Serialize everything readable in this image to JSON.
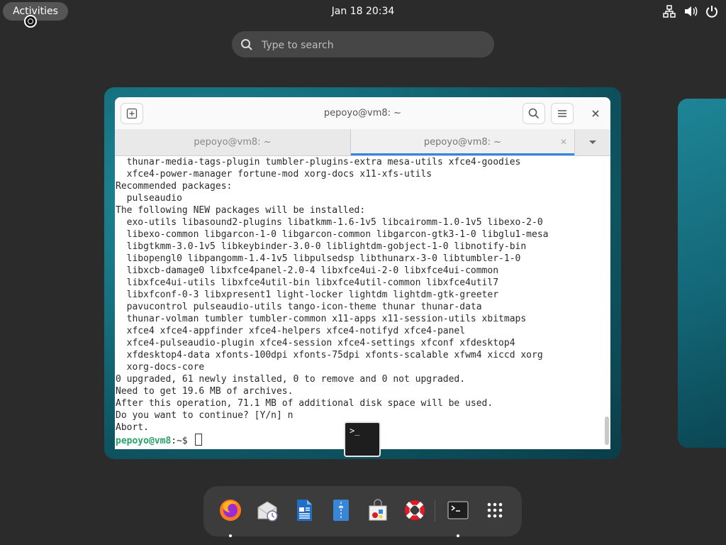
{
  "topbar": {
    "activities_label": "Activities",
    "datetime": "Jan 18  20:34",
    "tray_icons": [
      "network-icon",
      "volume-icon",
      "power-icon"
    ]
  },
  "search": {
    "placeholder": "Type to search"
  },
  "terminal": {
    "title": "pepoyo@vm8: ~",
    "tabs": [
      {
        "label": "pepoyo@vm8: ~",
        "active": false
      },
      {
        "label": "pepoyo@vm8: ~",
        "active": true
      }
    ],
    "lines": [
      "  thunar-media-tags-plugin tumbler-plugins-extra mesa-utils xfce4-goodies",
      "  xfce4-power-manager fortune-mod xorg-docs x11-xfs-utils",
      "Recommended packages:",
      "  pulseaudio",
      "The following NEW packages will be installed:",
      "  exo-utils libasound2-plugins libatkmm-1.6-1v5 libcairomm-1.0-1v5 libexo-2-0",
      "  libexo-common libgarcon-1-0 libgarcon-common libgarcon-gtk3-1-0 libglu1-mesa",
      "  libgtkmm-3.0-1v5 libkeybinder-3.0-0 liblightdm-gobject-1-0 libnotify-bin",
      "  libopengl0 libpangomm-1.4-1v5 libpulsedsp libthunarx-3-0 libtumbler-1-0",
      "  libxcb-damage0 libxfce4panel-2.0-4 libxfce4ui-2-0 libxfce4ui-common",
      "  libxfce4ui-utils libxfce4util-bin libxfce4util-common libxfce4util7",
      "  libxfconf-0-3 libxpresent1 light-locker lightdm lightdm-gtk-greeter",
      "  pavucontrol pulseaudio-utils tango-icon-theme thunar thunar-data",
      "  thunar-volman tumbler tumbler-common x11-apps x11-session-utils xbitmaps",
      "  xfce4 xfce4-appfinder xfce4-helpers xfce4-notifyd xfce4-panel",
      "  xfce4-pulseaudio-plugin xfce4-session xfce4-settings xfconf xfdesktop4",
      "  xfdesktop4-data xfonts-100dpi xfonts-75dpi xfonts-scalable xfwm4 xiccd xorg",
      "  xorg-docs-core",
      "0 upgraded, 61 newly installed, 0 to remove and 0 not upgraded.",
      "Need to get 19.6 MB of archives.",
      "After this operation, 71.1 MB of additional disk space will be used.",
      "Do you want to continue? [Y/n] n",
      "Abort."
    ],
    "prompt_user": "pepoyo@vm8",
    "prompt_path": ":~$ "
  },
  "dock": {
    "apps": [
      "firefox-icon",
      "evolution-icon",
      "writer-icon",
      "files-icon",
      "software-icon",
      "help-icon",
      "terminal-icon",
      "app-grid-icon"
    ]
  },
  "colors": {
    "accent": "#3584e4",
    "prompt_user": "#26a269",
    "desktop_teal": "#15707e"
  }
}
